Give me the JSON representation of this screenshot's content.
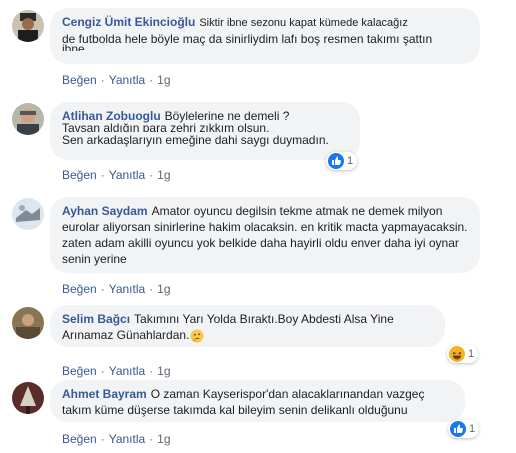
{
  "comments": [
    {
      "author": "Cengiz Ümit Ekincioğlu",
      "overlap_line": "Siktir ibne sezonu kapat kümede kalacağız",
      "text": "de futbolda hele böyle maç da sinirliydim lafı boş resmen takımı şattın",
      "trailing": "ibne",
      "like_label": "Beğen",
      "reply_label": "Yanıtla",
      "time": "1g"
    },
    {
      "author": "Atlihan Zobuoglu",
      "first_line": "Böylelerine ne demeli ?",
      "overlap_line": "Tavşan aldığın para zehri zıkkım olsun.",
      "text": "Sen arkadaşlarıyın emeğine dahi saygı duymadın.",
      "like_label": "Beğen",
      "reply_label": "Yanıtla",
      "time": "1g",
      "reaction": {
        "icon": "like-icon",
        "count": "1"
      }
    },
    {
      "author": "Ayhan Saydam",
      "text": "Amator oyuncu degilsin tekme atmak ne demek milyon eurolar aliyorsan sinirlerine hakim olacaksin. en kritik macta yapmayacaksin. zaten adam akilli oyuncu yok belkide daha hayirli oldu enver daha iyi oynar senin yerine",
      "like_label": "Beğen",
      "reply_label": "Yanıtla",
      "time": "1g"
    },
    {
      "author": "Selim Bağcı",
      "text": "Takımını Yarı Yolda Bıraktı.Boy Abdesti Alsa Yine Arınamaz Günahlardan.",
      "emoji": "thinking-face-emoji",
      "like_label": "Beğen",
      "reply_label": "Yanıtla",
      "time": "1g",
      "reaction": {
        "icon": "haha-icon",
        "count": "1"
      }
    },
    {
      "author": "Ahmet Bayram",
      "text": "O zaman Kayserispor'dan alacaklarınandan vazgeç takım küme düşerse takımda kal bileyim senin delikanlı olduğunu",
      "like_label": "Beğen",
      "reply_label": "Yanıtla",
      "time": "1g",
      "reaction": {
        "icon": "like-icon",
        "count": "1"
      }
    }
  ],
  "colors": {
    "author": "#385898",
    "bubble": "#f2f3f5",
    "meta": "#606770",
    "like_blue": "#1877f2",
    "haha_yellow": "#f7b125"
  }
}
